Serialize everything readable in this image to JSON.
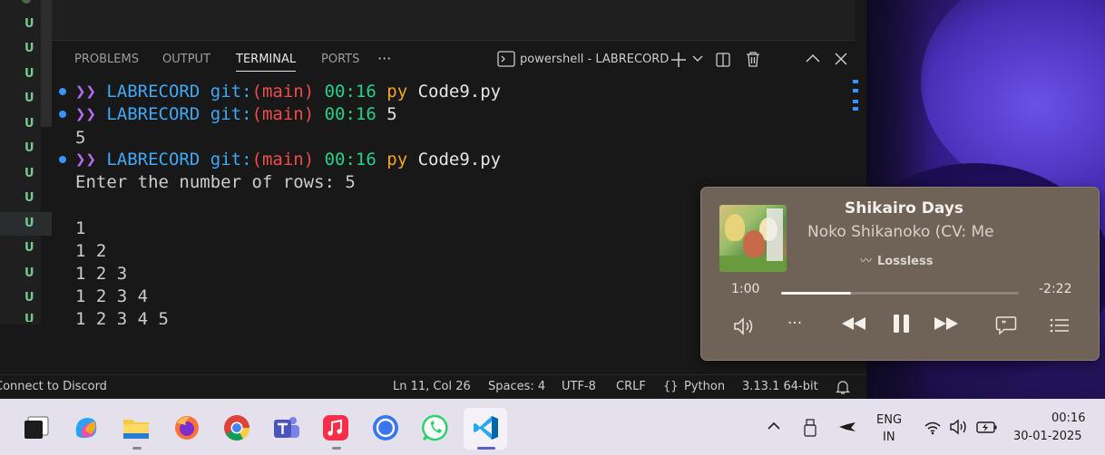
{
  "panel": {
    "tabs": [
      "PROBLEMS",
      "OUTPUT",
      "TERMINAL",
      "PORTS"
    ],
    "active_tab": "TERMINAL",
    "more": "···",
    "terminal_name": "powershell - LABRECORD"
  },
  "gutter_marks": [
    "U",
    "U",
    "U",
    "U",
    "U",
    "U",
    "U",
    "U",
    "U",
    "U",
    "U",
    "U",
    "U"
  ],
  "terminal": {
    "prompt_arrow": "❯❯",
    "cwd": "LABRECORD",
    "git": "git:",
    "branch": "(main)",
    "time": "00:16",
    "lines": [
      {
        "kind": "prompt",
        "cmd": "py",
        "arg": "Code9.py"
      },
      {
        "kind": "prompt",
        "cmd": "",
        "arg": "5"
      },
      {
        "kind": "output",
        "text": "5"
      },
      {
        "kind": "prompt",
        "cmd": "py",
        "arg": "Code9.py"
      },
      {
        "kind": "output",
        "text": "Enter the number of rows: 5"
      },
      {
        "kind": "output",
        "text": ""
      },
      {
        "kind": "output",
        "text": "1"
      },
      {
        "kind": "output",
        "text": "1 2"
      },
      {
        "kind": "output",
        "text": "1 2 3"
      },
      {
        "kind": "output",
        "text": "1 2 3 4"
      },
      {
        "kind": "output",
        "text": "1 2 3 4 5"
      },
      {
        "kind": "prompt",
        "cmd": "",
        "arg": "_"
      }
    ]
  },
  "status": {
    "left": "Connect to Discord",
    "position": "Ln 11, Col 26",
    "spaces": "Spaces: 4",
    "encoding": "UTF-8",
    "eol": "CRLF",
    "language": "Python",
    "language_icon": "{}",
    "interpreter": "3.13.1 64-bit"
  },
  "music": {
    "title": "Shikairo Days",
    "artist": "Noko Shikanoko (CV: Me",
    "quality": "Lossless",
    "elapsed": "1:00",
    "remaining": "-2:22",
    "progress": 0.295
  },
  "taskbar": {
    "language": "ENG",
    "region": "IN",
    "clock_time": "00:16",
    "clock_date": "30-01-2025"
  },
  "colors": {
    "terminal_bg": "#181818",
    "music_bg": "#6f6257",
    "taskbar_bg": "#e4e1ec"
  }
}
